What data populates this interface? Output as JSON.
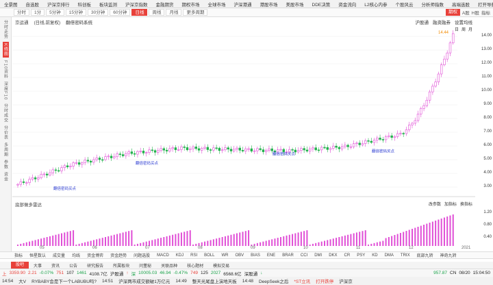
{
  "menubar": {
    "items": [
      "全景图",
      "自选股",
      "沪深京排行",
      "科创板",
      "板块监测",
      "沪深京指数",
      "金融期货",
      "期权市场",
      "全球市场",
      "沪深港通",
      "港股市场",
      "美股市场",
      "DDE决策",
      "资金流向",
      "L2核心内参",
      "个股风云",
      "分析师指数",
      "高端选股"
    ],
    "right": "打开导航"
  },
  "toolbar": {
    "periods": [
      "分时",
      "1分",
      "5分钟",
      "15分钟",
      "30分钟",
      "60分钟",
      "日线",
      "周线",
      "月线",
      "更多周期"
    ],
    "active": "日线",
    "right_items": [
      "期权",
      "A股",
      "H股",
      "指标"
    ]
  },
  "leftbar": {
    "items": [
      "分时走势",
      "K线图",
      "F10资料",
      "深度F10",
      "分时成交",
      "分价表",
      "多周期",
      "参数",
      "资金"
    ],
    "active": "K线图"
  },
  "chart": {
    "stock": "京运通",
    "adjust": "(日线,前复权)",
    "indicator": "翻倍密码系统",
    "rtools": [
      "沪股通",
      "融资融券",
      "设置均线"
    ],
    "rtools2": [
      "日",
      "周",
      "月"
    ],
    "sub_indicator": "底部做多雷达",
    "sub_right": [
      "改参数",
      "加指标",
      "换指标"
    ],
    "price_labels": [
      "14.00",
      "13.00",
      "12.00",
      "11.00",
      "10.00",
      "9.00",
      "8.00",
      "7.00",
      "6.00",
      "5.00",
      "4.00",
      "3.00"
    ],
    "sub_labels": [
      "1.20",
      "0.80",
      "0.40"
    ],
    "peak": "14.44",
    "dates": [
      "05",
      "06",
      "07",
      "08",
      "09",
      "10",
      "11",
      "12",
      "2021"
    ],
    "signal_label": "翻倍密码买点"
  },
  "chart_data": {
    "type": "candlestick",
    "stock": "京运通",
    "x": [
      "05",
      "06",
      "07",
      "08",
      "09",
      "10",
      "11",
      "12",
      "2021"
    ],
    "close": [
      3.3,
      4.8,
      5.6,
      6.0,
      5.9,
      5.8,
      6.1,
      7.0,
      14.44
    ],
    "peak": 14.44,
    "ylim": [
      3,
      14.5
    ]
  },
  "indicator_tabs": {
    "items": [
      "指标",
      "恒星数认",
      "成交量",
      "均线",
      "资金博弈",
      "资金趋势",
      "问题选股",
      "MACD",
      "KDJ",
      "RSI",
      "BOLL",
      "WR",
      "OBV",
      "BIAS",
      "ENE",
      "BRAR",
      "CCI",
      "DMI",
      "DKX",
      "CR",
      "PSY",
      "KD",
      "DMA",
      "TRIX",
      "底部九转",
      "神奇九转"
    ],
    "active": "指标"
  },
  "bottom_tabs": {
    "items": [
      "股吧",
      "大事",
      "资讯",
      "公告",
      "研究报告",
      "所属板块",
      "问董秘",
      "关联品种",
      "核心题材",
      "模拟交易"
    ],
    "active": "股吧"
  },
  "status": {
    "sh_label": "上",
    "sh_val": "3359.90",
    "sh_up": "2.21",
    "sh_pct": "-0.07%",
    "sh_amt": "751",
    "sh_n1": "107",
    "sh_n2": "1461",
    "sh_vol": "4108.7亿",
    "hk_label": "沪股通",
    "hk_val": "↑",
    "sz_label": "深",
    "sz_val": "10005.03",
    "sz_dn": "46.94",
    "sz_pct": "-0.47%",
    "sz_n1": "749",
    "sz_n2": "125",
    "sz_n3": "2027",
    "sz_vol": "6568.6亿",
    "sgt_label": "深股通",
    "sgt_val": "↓",
    "right_val": "957.87",
    "cn": "CN",
    "date": "08/20",
    "time": "15:04:50"
  },
  "news": {
    "items": [
      "14:54",
      "大V",
      "RYBABY会是下一个LABUBU吗?",
      "14:51",
      "沪深两市成交额破1万亿元",
      "14:49",
      "整天光尾盘上演地天板",
      "14:48",
      "DeepSeek之后",
      "*ST立讯",
      "打开跌停",
      "沪深京"
    ]
  }
}
